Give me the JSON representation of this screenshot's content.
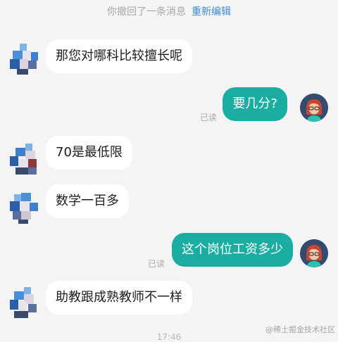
{
  "recall_notice": {
    "text": "你撤回了一条消息",
    "action": "重新编辑"
  },
  "messages": [
    {
      "text": "那您对哪科比较擅长呢"
    },
    {
      "text": "要几分?",
      "status": "已读"
    },
    {
      "text": "70是最低限"
    },
    {
      "text": "数学一百多"
    },
    {
      "text": "这个岗位工资多少",
      "status": "已读"
    },
    {
      "text": "助教跟成熟教师不一样"
    }
  ],
  "timestamp": "17:46",
  "watermark": "@稀土掘金技术社区",
  "colors": {
    "outgoing_bubble": "#1bada2",
    "incoming_bubble": "#ffffff",
    "background": "#f4f4f5",
    "link": "#3d8bd6"
  }
}
